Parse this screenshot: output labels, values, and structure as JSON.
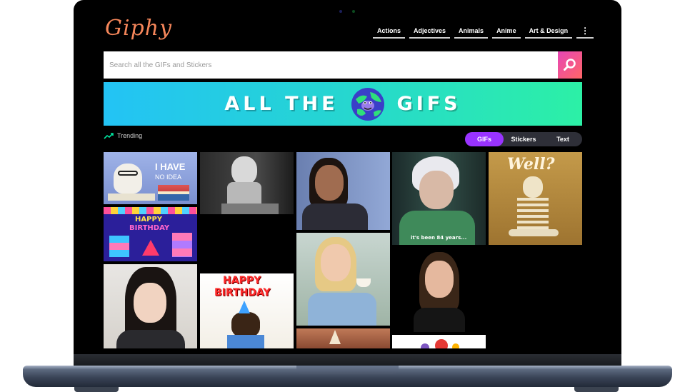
{
  "brand": {
    "logo_text": "Giphy"
  },
  "nav": {
    "items": [
      "Actions",
      "Adjectives",
      "Animals",
      "Anime",
      "Art & Design"
    ],
    "more": "⋮"
  },
  "search": {
    "placeholder": "Search all the GIFs and Stickers"
  },
  "banner": {
    "left_text": "ALL THE",
    "right_text": "GIFS"
  },
  "trending": {
    "label": "Trending"
  },
  "type_toggle": {
    "options": [
      "GIFs",
      "Stickers",
      "Text"
    ],
    "selected": "GIFs"
  },
  "gifs": {
    "dog_no_idea": {
      "line1": "I HAVE",
      "line2": "NO IDEA"
    },
    "birthday_gifts": {
      "line1": "HAPPY",
      "line2": "BIRTHDAY"
    },
    "skeleton": {
      "text": "Well?"
    },
    "old_woman": {
      "subtitle": "it's been 84 years..."
    },
    "dog_birthday": {
      "line1": "HAPPY",
      "line2": "BIRTHDAY"
    }
  },
  "colors": {
    "accent_purple": "#9933ff",
    "search_gradient": "#e646b6",
    "logo": "#f5865a"
  }
}
